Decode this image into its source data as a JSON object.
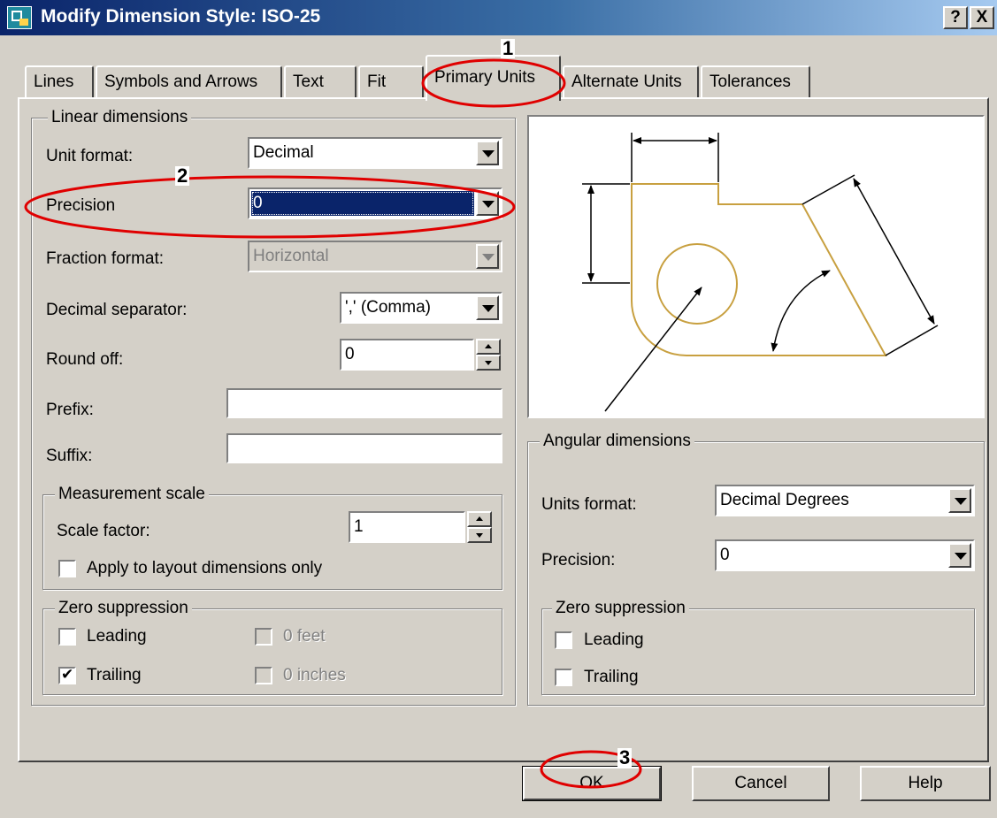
{
  "window": {
    "title": "Modify Dimension Style: ISO-25",
    "help_btn": "?",
    "close_btn": "X"
  },
  "tabs": [
    {
      "label": "Lines"
    },
    {
      "label": "Symbols and Arrows"
    },
    {
      "label": "Text"
    },
    {
      "label": "Fit"
    },
    {
      "label": "Primary Units"
    },
    {
      "label": "Alternate Units"
    },
    {
      "label": "Tolerances"
    }
  ],
  "linear": {
    "legend": "Linear dimensions",
    "unit_format_label": "Unit format:",
    "unit_format_value": "Decimal",
    "precision_label": "Precision",
    "precision_value": "0",
    "fraction_label": "Fraction format:",
    "fraction_value": "Horizontal",
    "decsep_label": "Decimal separator:",
    "decsep_value": "',' (Comma)",
    "roundoff_label": "Round off:",
    "roundoff_value": "0",
    "prefix_label": "Prefix:",
    "prefix_value": "",
    "suffix_label": "Suffix:",
    "suffix_value": ""
  },
  "measurement": {
    "legend": "Measurement scale",
    "scale_label": "Scale factor:",
    "scale_value": "1",
    "apply_label": "Apply to layout dimensions only",
    "apply_checked": false
  },
  "zero_linear": {
    "legend": "Zero suppression",
    "leading": "Leading",
    "leading_checked": false,
    "trailing": "Trailing",
    "trailing_checked": true,
    "feet": "0 feet",
    "inches": "0 inches"
  },
  "angular": {
    "legend": "Angular dimensions",
    "units_label": "Units format:",
    "units_value": "Decimal Degrees",
    "precision_label": "Precision:",
    "precision_value": "0"
  },
  "zero_angular": {
    "legend": "Zero suppression",
    "leading": "Leading",
    "leading_checked": false,
    "trailing": "Trailing",
    "trailing_checked": false
  },
  "buttons": {
    "ok": "OK",
    "cancel": "Cancel",
    "help": "Help"
  },
  "annotations": {
    "n1": "1",
    "n2": "2",
    "n3": "3",
    "color": "#e00000"
  },
  "colors": {
    "drawing": "#c8a040",
    "selection": "#0a246a"
  }
}
